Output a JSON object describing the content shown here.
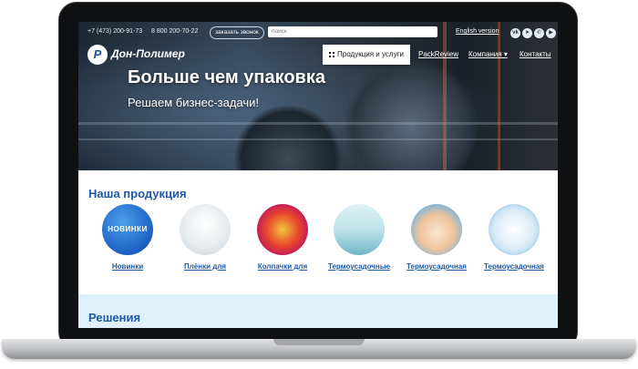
{
  "topbar": {
    "phone_1": "+7 (473) 200-91-73",
    "phone_2": "8 800 200-70-22",
    "callback_label": "заказать звонок",
    "search_placeholder": "поиск",
    "english_link": "English version",
    "social_icons": [
      "vk-icon",
      "telegram-icon",
      "whatsapp-icon",
      "youtube-icon"
    ],
    "social_glyphs": [
      "vk",
      "➤",
      "✆",
      "▶"
    ]
  },
  "header": {
    "logo_text": "Дон-Полимер",
    "logo_mark": "Р",
    "nav": {
      "products": "Продукция и услуги",
      "packreview": "PackReview",
      "company": "Компания ▾",
      "contacts": "Контакты"
    }
  },
  "hero": {
    "title": "Больше чем упаковка",
    "subtitle": "Решаем бизнес-задачи!"
  },
  "products": {
    "title": "Наша продукция",
    "items": [
      {
        "label": "Новинки",
        "badge": "НОВИНКИ"
      },
      {
        "label": "Плёнки для"
      },
      {
        "label": "Колпачки для"
      },
      {
        "label": "Термоусадочные"
      },
      {
        "label": "Термоусадочная"
      },
      {
        "label": "Термоусадочная"
      }
    ]
  },
  "solutions": {
    "title": "Решения"
  },
  "colors": {
    "accent": "#1e5aa8",
    "solutions_bg": "#dff0fa"
  }
}
